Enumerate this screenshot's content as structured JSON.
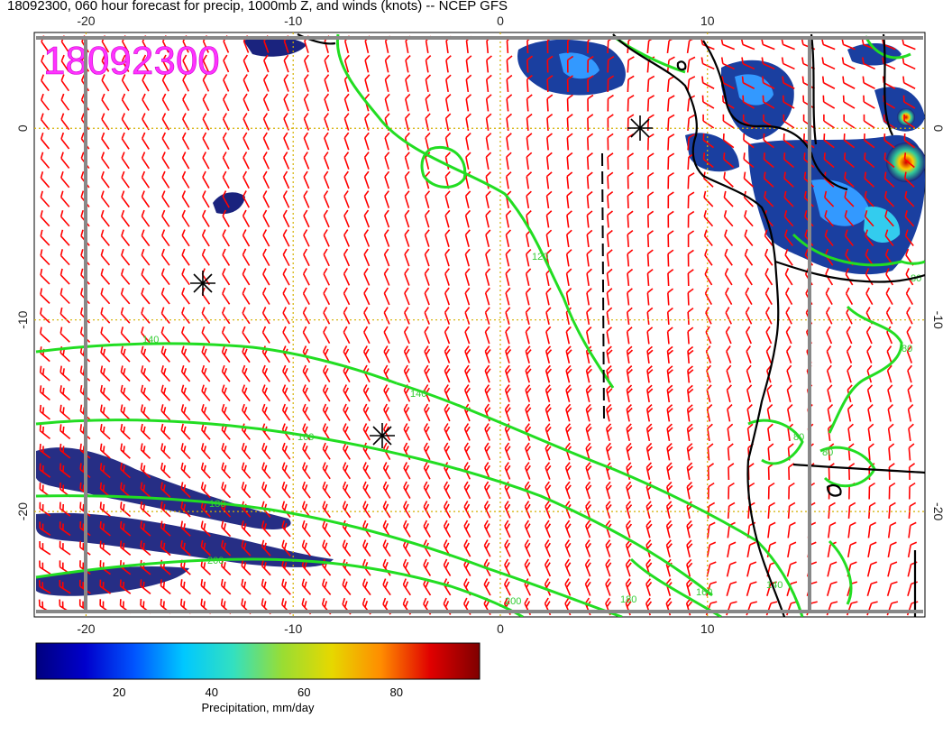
{
  "title": "18092300, 060 hour forecast for precip, 1000mb Z, and winds (knots) -- NCEP GFS",
  "stamp": "18092300",
  "map": {
    "lon_ticks_top": [
      "-20",
      "-10",
      "0",
      "10"
    ],
    "lon_ticks_bottom": [
      "-20",
      "-10",
      "0",
      "10"
    ],
    "lat_ticks_left": [
      "0",
      "-10",
      "-20"
    ],
    "lat_ticks_right": [
      "0",
      "-10",
      "-20"
    ],
    "lon_range": [
      -22.5,
      20.5
    ],
    "lat_range": [
      -25.5,
      5.0
    ],
    "colors": {
      "wind_barb": "#ff0000",
      "contour": "#22dd22",
      "coast": "#000000",
      "grid": "#d4b000",
      "precip_low": "#1a237e",
      "precip_mid": "#3399ff"
    }
  },
  "contours": {
    "labels": [
      "120",
      "140",
      "140",
      "160",
      "180",
      "180",
      "200",
      "200",
      "160",
      "140",
      "80",
      "80",
      "80",
      "80"
    ]
  },
  "colorbar": {
    "label": "Precipitation, mm/day",
    "ticks": [
      "20",
      "40",
      "60",
      "80"
    ],
    "range": [
      2,
      98
    ],
    "stops": [
      "#00007f",
      "#0000cc",
      "#0055ff",
      "#00c8ff",
      "#33e0c0",
      "#99dd33",
      "#e6d800",
      "#ff8c00",
      "#e00000",
      "#7f0000"
    ]
  }
}
